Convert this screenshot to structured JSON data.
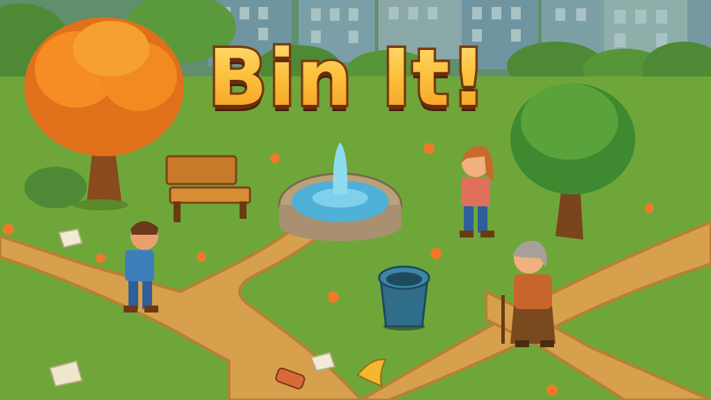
{
  "game": {
    "title": "Bin It!"
  },
  "colors": {
    "sky": "#5f8f6c",
    "grass": "#6fa63a",
    "grass_dark": "#4f8a2a",
    "path": "#d7a04c",
    "path_edge": "#b97f34",
    "title_fill": "#fbb22e",
    "title_outline": "#7a3a12",
    "autumn_tree": "#f08a1e",
    "green_tree": "#5aa33a",
    "water": "#4fb0d8",
    "bin": "#2f6d88"
  },
  "scene": {
    "objects": [
      "autumn-tree",
      "green-tree",
      "park-bench",
      "fountain",
      "trash-bin",
      "boy-character",
      "girl-character",
      "elderly-woman-character",
      "city-buildings",
      "hedges",
      "dirt-path"
    ],
    "litter": [
      "paper-litter",
      "paper-litter",
      "paper-litter",
      "soda-can-litter",
      "banana-peel-litter",
      "crumpled-paper-litter",
      "fallen-leaves"
    ]
  }
}
